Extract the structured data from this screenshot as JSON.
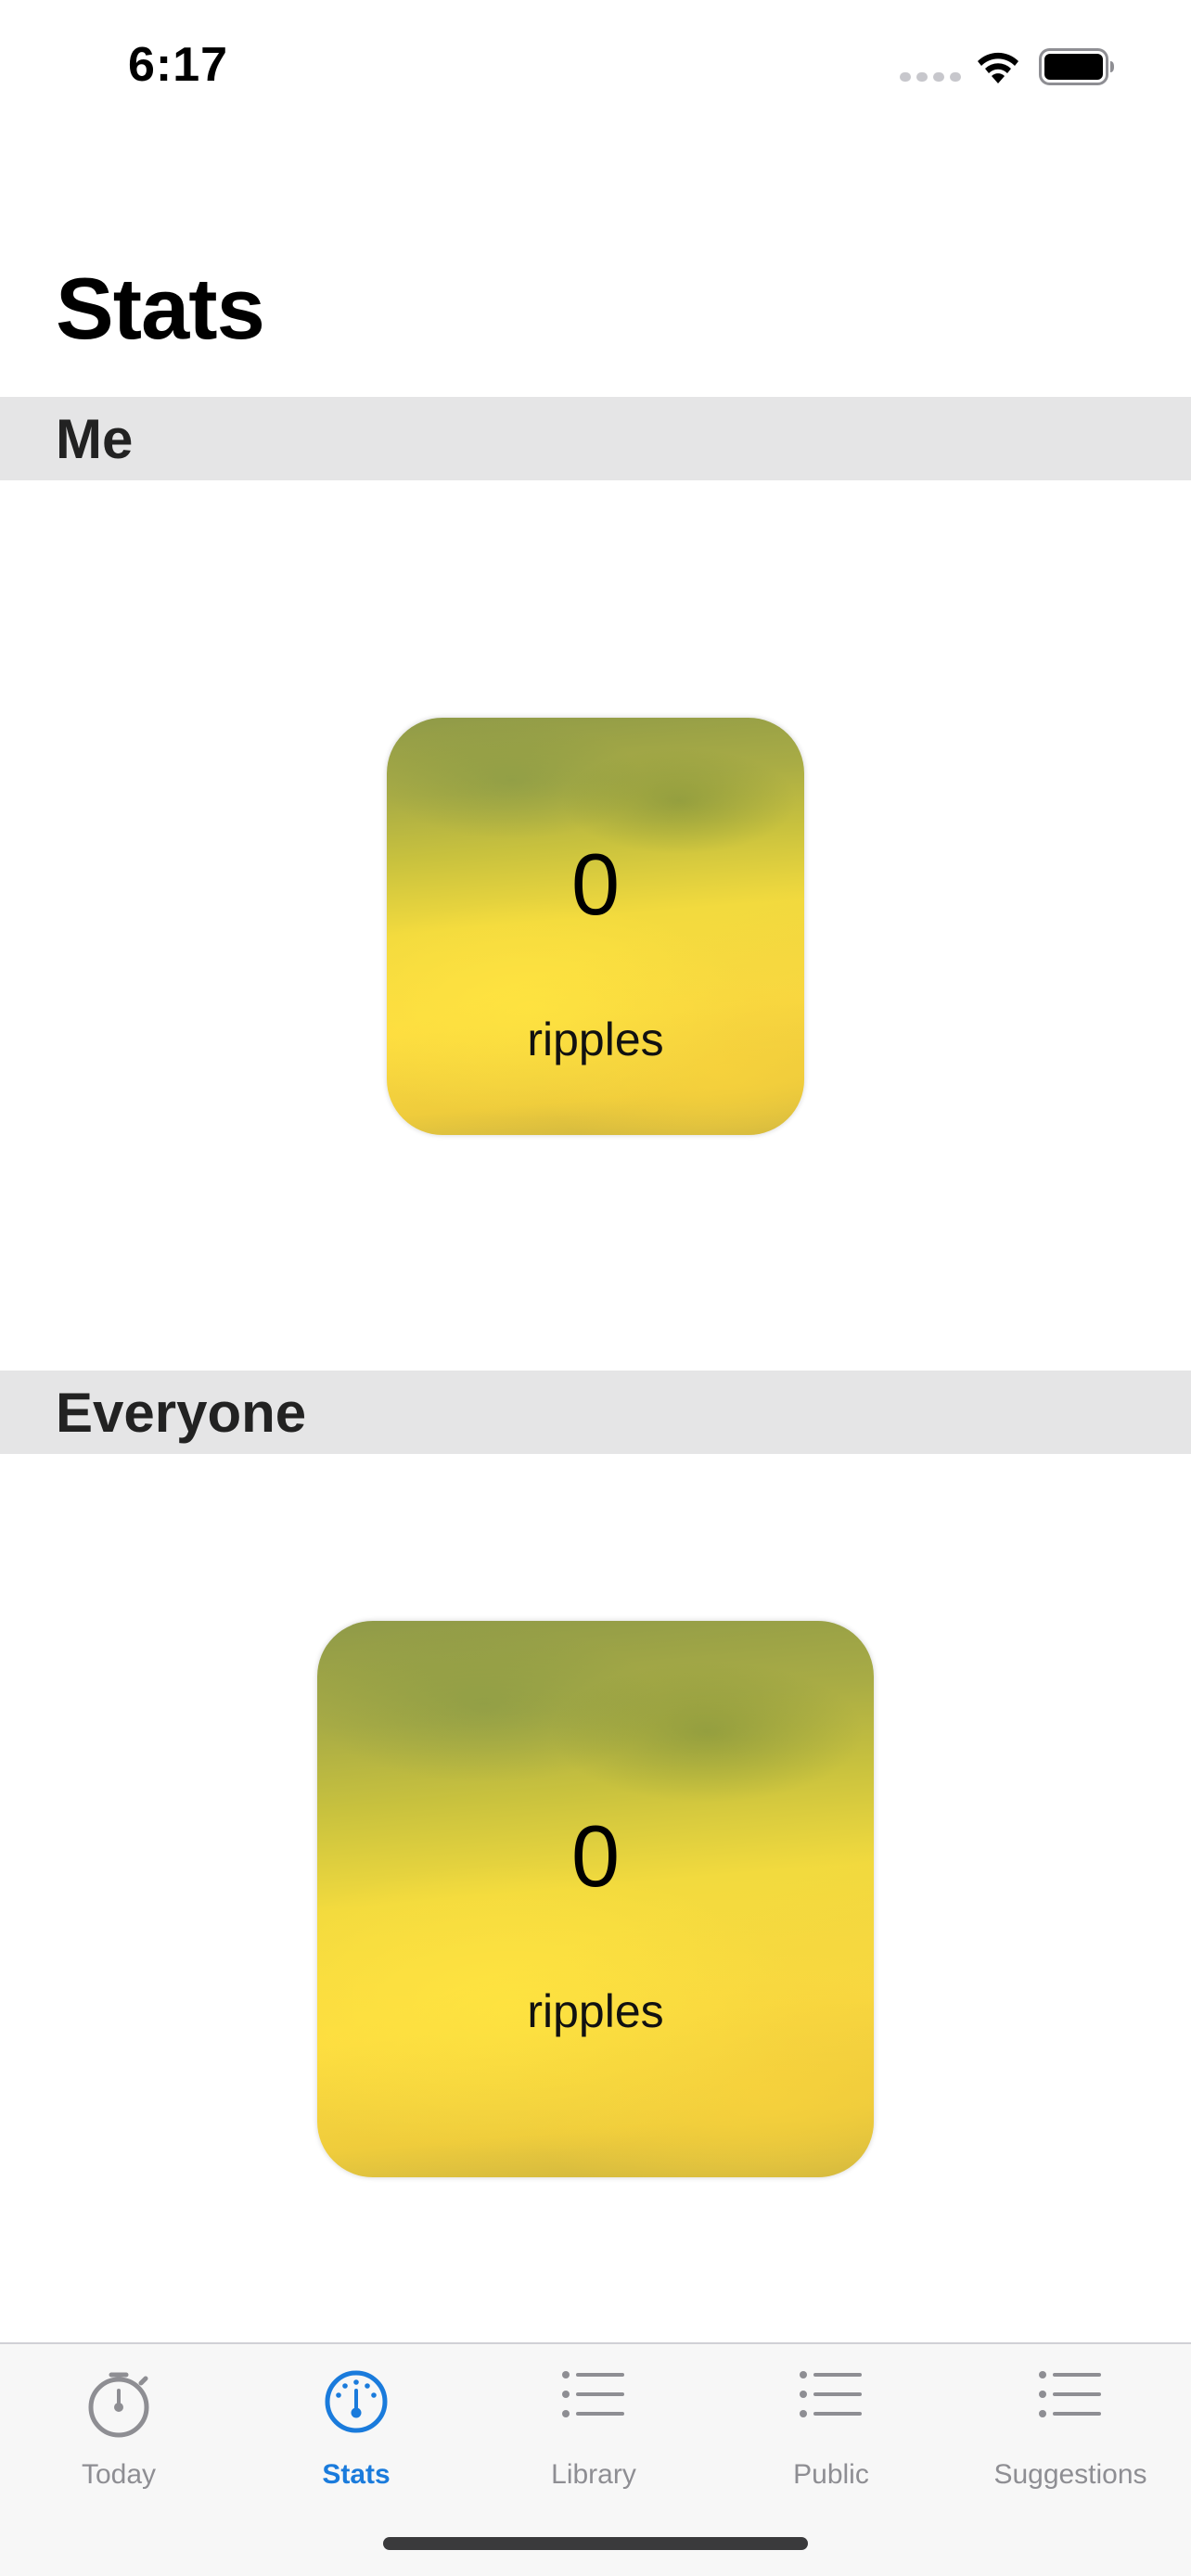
{
  "status_bar": {
    "time": "6:17",
    "icons": [
      "signal-dots-icon",
      "wifi-icon",
      "battery-icon"
    ]
  },
  "page": {
    "title": "Stats"
  },
  "sections": [
    {
      "header": "Me",
      "card": {
        "value": "0",
        "label": "ripples"
      }
    },
    {
      "header": "Everyone",
      "card": {
        "value": "0",
        "label": "ripples"
      }
    }
  ],
  "tab_bar": {
    "active_tab": "Stats",
    "active_color": "#1a7bdc",
    "inactive_color": "#8e8e93",
    "tabs": [
      {
        "label": "Today",
        "icon": "stopwatch-icon"
      },
      {
        "label": "Stats",
        "icon": "gauge-icon"
      },
      {
        "label": "Library",
        "icon": "list-icon"
      },
      {
        "label": "Public",
        "icon": "list-icon"
      },
      {
        "label": "Suggestions",
        "icon": "list-icon"
      }
    ]
  }
}
